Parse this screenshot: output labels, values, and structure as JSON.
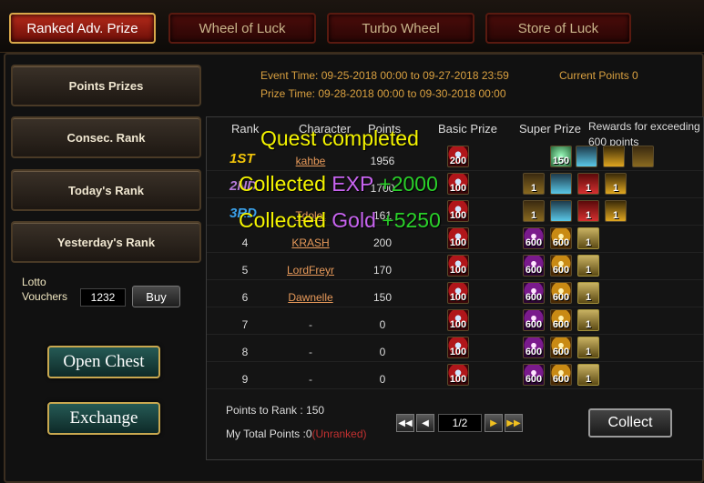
{
  "tabs": [
    {
      "label": "Ranked Adv. Prize",
      "active": true
    },
    {
      "label": "Wheel of Luck",
      "active": false
    },
    {
      "label": "Turbo Wheel",
      "active": false
    },
    {
      "label": "Store of Luck",
      "active": false
    }
  ],
  "sidebar": {
    "points_prizes": "Points Prizes",
    "consec_rank": "Consec. Rank",
    "todays_rank": "Today's Rank",
    "yesterdays_rank": "Yesterday's Rank",
    "lotto_label": "Lotto",
    "vouchers_label": "Vouchers",
    "vouchers_value": "1232",
    "buy_label": "Buy",
    "open_chest": "Open Chest",
    "exchange": "Exchange"
  },
  "event": {
    "event_time": "Event Time: 09-25-2018 00:00 to 09-27-2018 23:59",
    "prize_time": "Prize Time: 09-28-2018 00:00 to 09-30-2018 00:00",
    "current_points": "Current Points 0"
  },
  "table": {
    "headers": {
      "rank": "Rank",
      "character": "Character",
      "points": "Points",
      "basic": "Basic Prize",
      "super": "Super Prize"
    },
    "rewards_note_1": "Rewards for exceeding",
    "rewards_note_2": "600 points",
    "rows": [
      {
        "rank": "1ST",
        "character": "kahbe",
        "points": "1956",
        "basic": "200"
      },
      {
        "rank": "2ND",
        "character": "",
        "points": "1700",
        "basic": "100"
      },
      {
        "rank": "3RD",
        "character": "Tdolet",
        "points": "161",
        "basic": "100"
      },
      {
        "rank": "4",
        "character": "KRASH",
        "points": "200",
        "basic": "100"
      },
      {
        "rank": "5",
        "character": "LordFreyr",
        "points": "170",
        "basic": "100"
      },
      {
        "rank": "6",
        "character": "Dawnelle",
        "points": "150",
        "basic": "100"
      },
      {
        "rank": "7",
        "character": "-",
        "points": "0",
        "basic": "100"
      },
      {
        "rank": "8",
        "character": "-",
        "points": "0",
        "basic": "100"
      },
      {
        "rank": "9",
        "character": "-",
        "points": "0",
        "basic": "100"
      }
    ],
    "super_row1": [
      "150",
      "",
      "",
      ""
    ],
    "super_row23": [
      "1",
      "",
      "1",
      "1"
    ],
    "super_std": [
      "600",
      "600",
      "1"
    ]
  },
  "footer": {
    "points_to_rank": "Points to Rank : 150",
    "my_total_prefix": "My Total Points :0",
    "my_total_suffix": "(Unranked)",
    "page": "1/2",
    "collect": "Collect"
  },
  "overlay": {
    "quest": "Quest completed",
    "collected": "Collected",
    "exp_label": "EXP",
    "exp_value": "+2000",
    "gold_label": "Gold",
    "gold_value": "+5250"
  }
}
